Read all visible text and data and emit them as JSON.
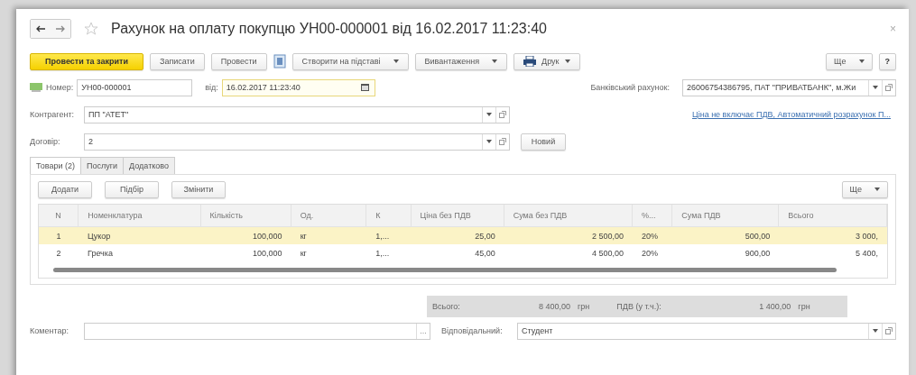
{
  "window": {
    "title": "Рахунок на оплату покупцю УН00-000001 від 16.02.2017 11:23:40",
    "close": "×"
  },
  "toolbar": {
    "buttons": [
      {
        "kind": "primary",
        "label": "Провести та закрити"
      },
      {
        "kind": "plain",
        "label": "Записати"
      },
      {
        "kind": "plain",
        "label": "Провести"
      },
      {
        "kind": "icon"
      },
      {
        "kind": "menu",
        "label": "Створити на підставі"
      },
      {
        "kind": "menu",
        "label": "Вивантаження"
      },
      {
        "kind": "print",
        "label": "Друк"
      }
    ],
    "more": "Ще",
    "help": "?"
  },
  "header": {
    "number_label": "Номер:",
    "number": "УН00-000001",
    "date_label": "від:",
    "date": "16.02.2017 11:23:40",
    "bank_label": "Банківський рахунок:",
    "bank": "26006754386795, ПАТ \"ПРИВАТБАНК\", м.Жи",
    "counterparty_label": "Контрагент:",
    "counterparty": "ПП \"АТЕТ\"",
    "price_link": "Ціна не включає ПДВ, Автоматичний розрахунок П...",
    "contract_label": "Договір:",
    "contract": "2",
    "new_button": "Новий"
  },
  "tabs": [
    {
      "label": "Товари (2)",
      "selected": true
    },
    {
      "label": "Послуги",
      "selected": false
    },
    {
      "label": "Додатково",
      "selected": false
    }
  ],
  "table_toolbar": {
    "buttons": [
      "Додати",
      "Підбір",
      "Змінити"
    ],
    "more": "Ще"
  },
  "table": {
    "columns": [
      "N",
      "Номенклатура",
      "Кількість",
      "Од.",
      "К",
      "Ціна без ПДВ",
      "Сума без ПДВ",
      "%...",
      "Сума ПДВ",
      "Всього"
    ],
    "rows": [
      {
        "selected": true,
        "cells": [
          "1",
          "Цукор",
          "100,000",
          "кг",
          "1,...",
          "25,00",
          "2 500,00",
          "20%",
          "500,00",
          "3 000,"
        ]
      },
      {
        "selected": false,
        "cells": [
          "2",
          "Гречка",
          "100,000",
          "кг",
          "1,...",
          "45,00",
          "4 500,00",
          "20%",
          "900,00",
          "5 400,"
        ]
      }
    ]
  },
  "totals": {
    "total_label": "Всього:",
    "total": "8 400,00",
    "total_currency": "грн",
    "vat_label": "ПДВ (у т.ч.):",
    "vat": "1 400,00",
    "vat_currency": "грн"
  },
  "footer": {
    "comment_label": "Коментар:",
    "ellipsis": "...",
    "responsible_label": "Відповідальний:",
    "responsible": "Студент"
  }
}
